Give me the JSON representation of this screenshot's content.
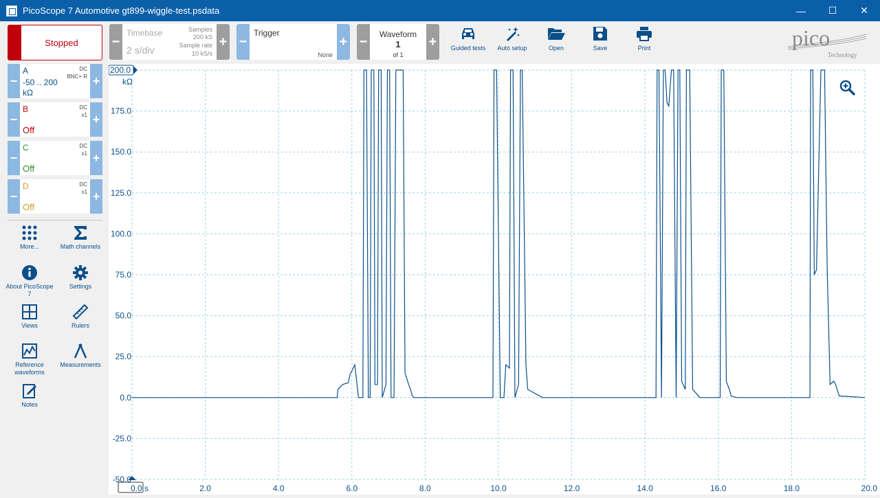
{
  "window": {
    "title": "PicoScope 7 Automotive gt899-wiggle-test.psdata",
    "minimize": "—",
    "maximize": "☐",
    "close": "✕"
  },
  "toolbar": {
    "stop_label": "Stopped",
    "timebase": {
      "title": "Timebase",
      "value": "2 s/div",
      "samples_label": "Samples",
      "samples_value": "200 kS",
      "rate_label": "Sample rate",
      "rate_value": "10 kS/s"
    },
    "trigger": {
      "title": "Trigger",
      "mode": "None"
    },
    "waveform": {
      "title": "Waveform",
      "current": "1",
      "of": "of 1"
    },
    "tools": [
      {
        "label": "Guided tests",
        "icon": "car-icon"
      },
      {
        "label": "Auto setup",
        "icon": "magic-wand-icon"
      },
      {
        "label": "Open",
        "icon": "folder-open-icon"
      },
      {
        "label": "Save",
        "icon": "floppy-disk-icon"
      },
      {
        "label": "Print",
        "icon": "printer-icon"
      }
    ],
    "logo": {
      "text": "pico",
      "sub": "Technology"
    }
  },
  "channels": [
    {
      "name": "A",
      "coupling": "DC",
      "probe": "BNC+ R",
      "range": "-50 .. 200",
      "unit": "kΩ",
      "state": "",
      "color": "#0b4f8a"
    },
    {
      "name": "B",
      "coupling": "DC",
      "probe": "x1",
      "range": "",
      "unit": "",
      "state": "Off",
      "color": "#c0000a"
    },
    {
      "name": "C",
      "coupling": "DC",
      "probe": "x1",
      "range": "",
      "unit": "",
      "state": "Off",
      "color": "#2e8b2e"
    },
    {
      "name": "D",
      "coupling": "DC",
      "probe": "x1",
      "range": "",
      "unit": "",
      "state": "Off",
      "color": "#c9a227"
    }
  ],
  "sidebar_tools": [
    {
      "label": "More...",
      "icon": "grid-dots-icon"
    },
    {
      "label": "Math channels",
      "icon": "sigma-icon"
    },
    {
      "label": "About PicoScope 7",
      "icon": "info-icon"
    },
    {
      "label": "Settings",
      "icon": "gear-icon"
    },
    {
      "label": "Views",
      "icon": "views-grid-icon"
    },
    {
      "label": "Rulers",
      "icon": "ruler-icon"
    },
    {
      "label": "Reference waveforms",
      "icon": "reference-waveform-icon"
    },
    {
      "label": "Measurements",
      "icon": "compass-icon"
    },
    {
      "label": "Notes",
      "icon": "notes-icon"
    }
  ],
  "colors": {
    "accent": "#0b5fa8",
    "trace": "#0b4f8a",
    "stop": "#c0000a",
    "grid": "#9ecfe0"
  },
  "chart_data": {
    "type": "line",
    "x_unit": "s",
    "y_unit": "kΩ",
    "xlim": [
      0,
      20
    ],
    "ylim": [
      -50,
      200
    ],
    "x_ticks": [
      "0.0 s",
      "2.0",
      "4.0",
      "6.0",
      "8.0",
      "10.0",
      "12.0",
      "14.0",
      "16.0",
      "18.0",
      "20.0"
    ],
    "y_ticks": [
      "-50.0",
      "-25.0",
      "0.0",
      "25.0",
      "50.0",
      "75.0",
      "100.0",
      "125.0",
      "150.0",
      "175.0",
      "200.0"
    ],
    "y_top_label": "200.0",
    "y_unit_label": "kΩ",
    "grid": true,
    "series": [
      {
        "values_x": [
          0,
          5.6,
          5.62,
          5.75,
          5.9,
          5.95,
          6.08,
          6.18,
          6.3,
          6.33,
          6.4,
          6.45,
          6.5,
          6.53,
          6.6,
          6.63,
          6.7,
          6.73,
          6.8,
          6.83,
          6.93,
          6.97,
          7.03,
          7.07,
          7.15,
          7.2,
          7.4,
          7.45,
          7.55,
          7.6,
          7.65,
          7.7,
          7.93,
          9.85,
          9.88,
          9.95,
          10.05,
          10.15,
          10.2,
          10.3,
          10.33,
          10.4,
          10.45,
          10.55,
          10.6,
          10.65,
          10.75,
          10.8,
          11.2,
          11.25,
          11.33,
          11.4,
          11.6,
          14.3,
          14.33,
          14.38,
          14.45,
          14.5,
          14.55,
          14.6,
          14.65,
          14.72,
          14.78,
          14.85,
          14.9,
          14.95,
          15.0,
          15.1,
          15.13,
          15.22,
          15.3,
          15.5,
          16.05,
          16.08,
          16.15,
          16.22,
          16.3,
          16.35,
          16.5,
          16.55,
          18.5,
          18.52,
          18.58,
          18.62,
          18.68,
          18.75,
          18.8,
          18.9,
          18.97,
          19.05,
          19.15,
          19.2,
          19.3,
          20
        ],
        "values_y": [
          0,
          0,
          5,
          8,
          9,
          14,
          20,
          0,
          0,
          200,
          200,
          0,
          0,
          200,
          200,
          8,
          8,
          200,
          200,
          0,
          8,
          200,
          200,
          0,
          0,
          200,
          200,
          15,
          8,
          5,
          1,
          0,
          0,
          0,
          200,
          200,
          0,
          0,
          20,
          18,
          200,
          200,
          0,
          8,
          200,
          200,
          20,
          5,
          0,
          0,
          0,
          0,
          0,
          0,
          200,
          200,
          0,
          200,
          200,
          180,
          178,
          200,
          200,
          0,
          200,
          200,
          10,
          5,
          200,
          200,
          5,
          0,
          0,
          200,
          200,
          10,
          5,
          1,
          0,
          0,
          0,
          200,
          200,
          75,
          78,
          150,
          200,
          200,
          80,
          8,
          10,
          8,
          1,
          0
        ]
      }
    ]
  }
}
